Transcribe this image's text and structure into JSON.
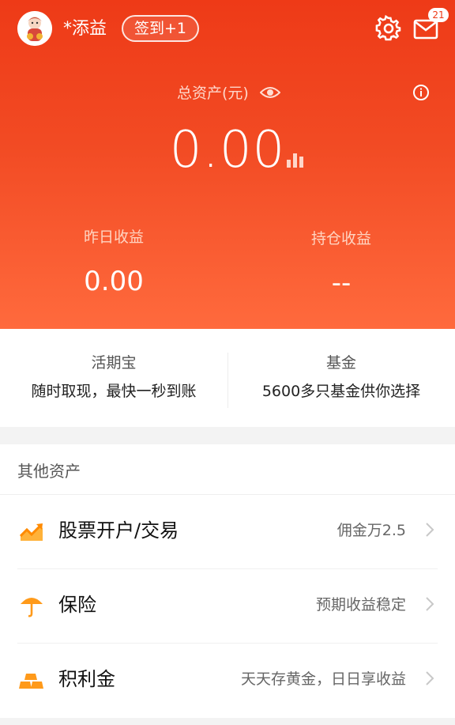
{
  "header": {
    "username": "*添益",
    "signin_label": "签到+1",
    "mail_badge": "21",
    "icons": [
      "settings-icon",
      "mail-icon"
    ]
  },
  "assets": {
    "total_label": "总资产(元)",
    "total_value": "0.00",
    "yesterday_label": "昨日收益",
    "yesterday_value": "0.00",
    "holding_label": "持仓收益",
    "holding_value": "--"
  },
  "products": [
    {
      "title": "活期宝",
      "desc": "随时取现，最快一秒到账"
    },
    {
      "title": "基金",
      "desc": "5600多只基金供你选择"
    }
  ],
  "other": {
    "title": "其他资产",
    "items": [
      {
        "label": "股票开户/交易",
        "right": "佣金万2.5",
        "icon": "stock-trend-icon"
      },
      {
        "label": "保险",
        "right": "预期收益稳定",
        "icon": "umbrella-icon"
      },
      {
        "label": "积利金",
        "right": "天天存黄金，日日享收益",
        "icon": "gold-bars-icon"
      }
    ]
  },
  "colors": {
    "brand_top": "#ee3a17",
    "brand_bottom": "#ff6a3d",
    "icon_orange": "#ff9a1a"
  }
}
